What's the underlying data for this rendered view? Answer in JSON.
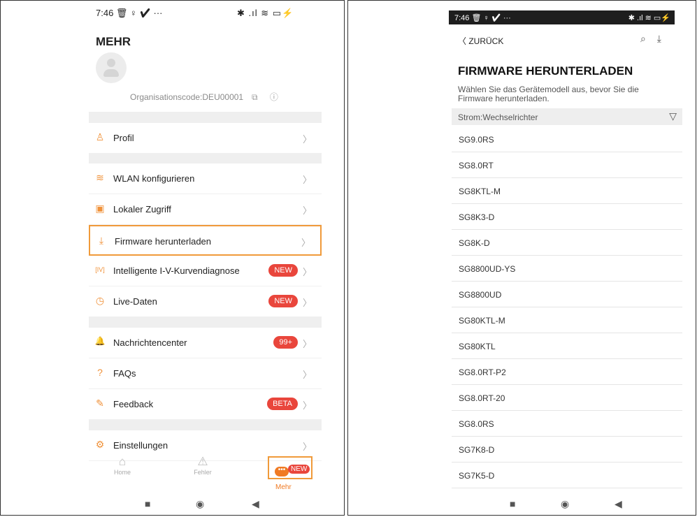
{
  "left": {
    "status_time": "7:46 🗑 ♀ ✔ ···",
    "status_icons": "✱ .ıl ≋ ▭⚡",
    "title": "MEHR",
    "org_code": "Organisationscode:DEU00001",
    "org_icons": [
      "⧉",
      "ⓘ"
    ],
    "menu": [
      {
        "icon": "person",
        "glyph": "♙",
        "label": "Profil",
        "badge": ""
      },
      {
        "icon": "wifi",
        "glyph": "≋",
        "label": "WLAN konfigurieren",
        "badge": ""
      },
      {
        "icon": "local-access",
        "glyph": "▣",
        "label": "Lokaler Zugriff",
        "badge": ""
      },
      {
        "icon": "download",
        "glyph": "⤓",
        "label": "Firmware herunterladen",
        "badge": ""
      },
      {
        "icon": "iv-curve",
        "glyph": "[IV]",
        "label": "Intelligente I-V-Kurvendiagnose",
        "badge": "NEW"
      },
      {
        "icon": "timer",
        "glyph": "◷",
        "label": "Live-Daten",
        "badge": "NEW"
      },
      {
        "icon": "bell",
        "glyph": "🔔",
        "label": "Nachrichtencenter",
        "badge": "99+"
      },
      {
        "icon": "question",
        "glyph": "?",
        "label": "FAQs",
        "badge": ""
      },
      {
        "icon": "feedback",
        "glyph": "✎",
        "label": "Feedback",
        "badge": "BETA"
      },
      {
        "icon": "gear",
        "glyph": "⚙",
        "label": "Einstellungen",
        "badge": ""
      }
    ],
    "tabs": {
      "home": {
        "glyph": "⌂",
        "label": "Home"
      },
      "fehler": {
        "glyph": "⚠",
        "label": "Fehler"
      },
      "mehr": {
        "glyph": "•••",
        "label": "Mehr",
        "badge": "NEW"
      }
    }
  },
  "right": {
    "status_time": "7:46 🗑 ♀ ✔ ···",
    "status_icons": "✱ .ıl ≋ ▭⚡",
    "back_label": "〈 ZURÜCK",
    "header_icons": [
      "⌕",
      "⤓"
    ],
    "title": "FIRMWARE HERUNTERLADEN",
    "description": "Wählen Sie das Gerätemodell aus, bevor Sie die Firmware herunterladen.",
    "filter_label": "Strom:Wechselrichter",
    "filter_icon": "▽",
    "models": [
      "SG9.0RS",
      "SG8.0RT",
      "SG8KTL-M",
      "SG8K3-D",
      "SG8K-D",
      "SG8800UD-YS",
      "SG8800UD",
      "SG80KTL-M",
      "SG80KTL",
      "SG8.0RT-P2",
      "SG8.0RT-20",
      "SG8.0RS",
      "SG7K8-D",
      "SG7K5-D"
    ]
  },
  "nav": {
    "square": "■",
    "circle": "◉",
    "back": "◀"
  },
  "colors": {
    "accent": "#f07a23",
    "highlight_border": "#f09a3a",
    "badge_red": "#e9463c"
  }
}
